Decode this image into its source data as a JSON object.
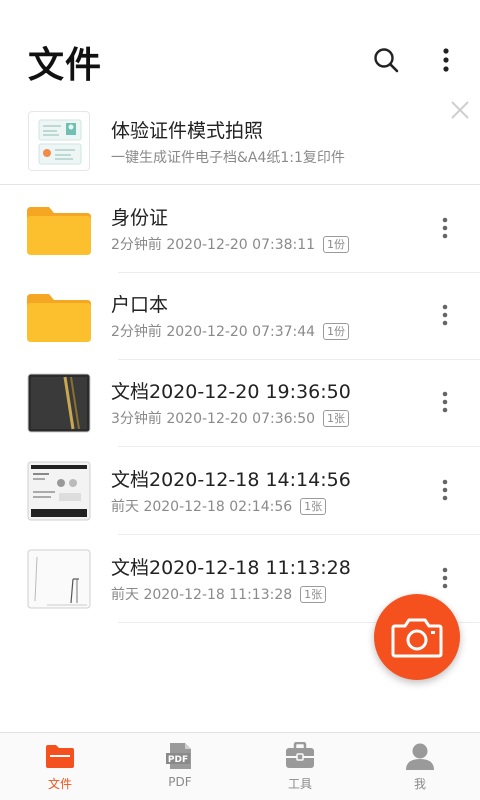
{
  "header": {
    "title": "文件"
  },
  "promo": {
    "title": "体验证件模式拍照",
    "subtitle": "一键生成证件电子档&A4纸1:1复印件"
  },
  "files": [
    {
      "title": "身份证",
      "meta": "2分钟前 2020-12-20 07:38:11",
      "badge": "1份",
      "type": "folder"
    },
    {
      "title": "户口本",
      "meta": "2分钟前 2020-12-20 07:37:44",
      "badge": "1份",
      "type": "folder"
    },
    {
      "title": "文档2020-12-20 19:36:50",
      "meta": "3分钟前 2020-12-20 07:36:50",
      "badge": "1张",
      "type": "photo-dark"
    },
    {
      "title": "文档2020-12-18 14:14:56",
      "meta": "前天 2020-12-18 02:14:56",
      "badge": "1张",
      "type": "photo-screen"
    },
    {
      "title": "文档2020-12-18 11:13:28",
      "meta": "前天 2020-12-18 11:13:28",
      "badge": "1张",
      "type": "photo-sketch"
    }
  ],
  "nav": {
    "items": [
      {
        "label": "文件",
        "icon": "folder-icon",
        "active": true
      },
      {
        "label": "PDF",
        "icon": "pdf-icon",
        "active": false
      },
      {
        "label": "工具",
        "icon": "toolbox-icon",
        "active": false
      },
      {
        "label": "我",
        "icon": "person-icon",
        "active": false
      }
    ],
    "pdf_icon_text": "PDF"
  },
  "colors": {
    "accent": "#f4511e",
    "folder": "#fcbf2e"
  }
}
